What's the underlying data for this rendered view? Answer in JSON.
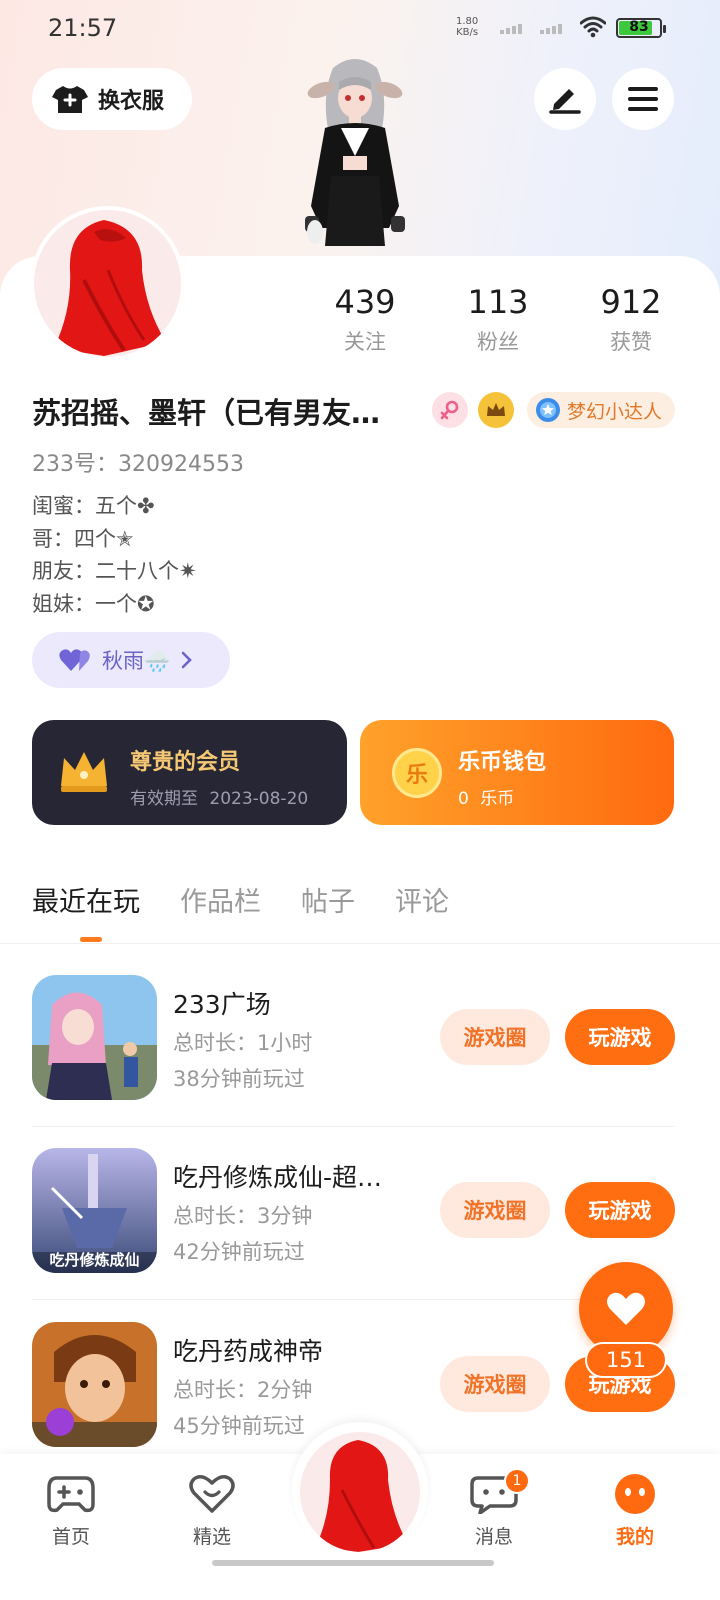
{
  "status_bar": {
    "time": "21:57",
    "net_speed_value": "1.80",
    "net_speed_unit": "KB/s",
    "battery": "83"
  },
  "header": {
    "dress_label": "换衣服"
  },
  "stats": [
    {
      "value": "439",
      "label": "关注"
    },
    {
      "value": "113",
      "label": "粉丝"
    },
    {
      "value": "912",
      "label": "获赞"
    }
  ],
  "profile": {
    "nickname": "苏招摇、墨轩（已有男友…",
    "title_badge": "梦幻小达人",
    "id_line": "233号：320924553",
    "bio": [
      "闺蜜：五个✤",
      "哥：四个✭",
      "朋友：二十八个✷",
      "姐妹：一个✪"
    ],
    "mood": "秋雨🌧️"
  },
  "cards": {
    "vip": {
      "title": "尊贵的会员",
      "sub_label": "有效期至",
      "expiry": "2023-08-20"
    },
    "wallet": {
      "title": "乐币钱包",
      "balance": "0",
      "unit": "乐币",
      "coin_char": "乐"
    }
  },
  "tabs": [
    "最近在玩",
    "作品栏",
    "帖子",
    "评论"
  ],
  "games": [
    {
      "name": "233广场",
      "duration": "总时长：1小时",
      "last_played": "38分钟前玩过",
      "circle_label": "游戏圈",
      "play_label": "玩游戏"
    },
    {
      "name": "吃丹修炼成仙-超…",
      "duration": "总时长：3分钟",
      "last_played": "42分钟前玩过",
      "circle_label": "游戏圈",
      "play_label": "玩游戏",
      "icon_caption": "吃丹修炼成仙"
    },
    {
      "name": "吃丹药成神帝",
      "duration": "总时长：2分钟",
      "last_played": "45分钟前玩过",
      "circle_label": "游戏圈",
      "play_label": "玩游戏"
    }
  ],
  "fab": {
    "count": "151"
  },
  "nav": {
    "items": [
      {
        "label": "首页"
      },
      {
        "label": "精选"
      },
      {
        "label": "消息"
      },
      {
        "label": "我的"
      }
    ],
    "message_badge": "1"
  },
  "colors": {
    "accent": "#ff6a10",
    "vip_card": "#262634",
    "mood_chip": "#ebe9fb"
  }
}
